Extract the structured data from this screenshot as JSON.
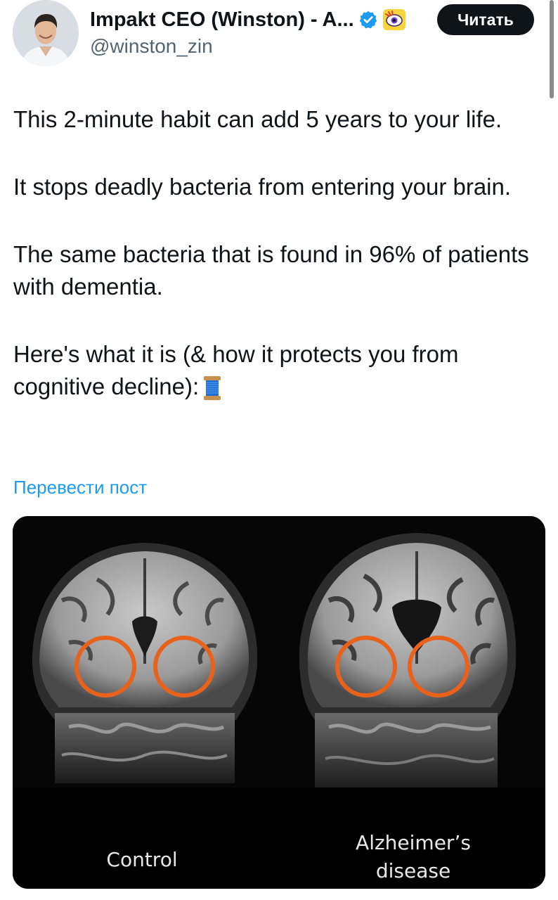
{
  "author": {
    "display_name": "Impakt CEO (Winston) - A...",
    "handle": "@winston_zin",
    "verified": true,
    "badge_icon": "cartoon-eye-badge-icon"
  },
  "follow_button": {
    "label": "Читать"
  },
  "tweet": {
    "paragraphs": [
      "This 2-minute habit can add 5 years to your life.",
      "It stops deadly bacteria from entering your brain.",
      "The same bacteria that is found in 96% of patients with dementia.",
      "Here's what it is (& how it protects you from cognitive decline):"
    ],
    "trailing_emoji_icon": "thread-spool-icon"
  },
  "translate_link": {
    "label": "Перевести пост"
  },
  "media": {
    "labels": {
      "left": "Control",
      "right_line1": "Alzheimer’s",
      "right_line2": "disease"
    },
    "highlight_color": "#e8621c"
  },
  "colors": {
    "link": "#1d9bf0",
    "verified": "#1d9bf0",
    "follow_button_bg": "#0f1419",
    "secondary_text": "#536471"
  }
}
